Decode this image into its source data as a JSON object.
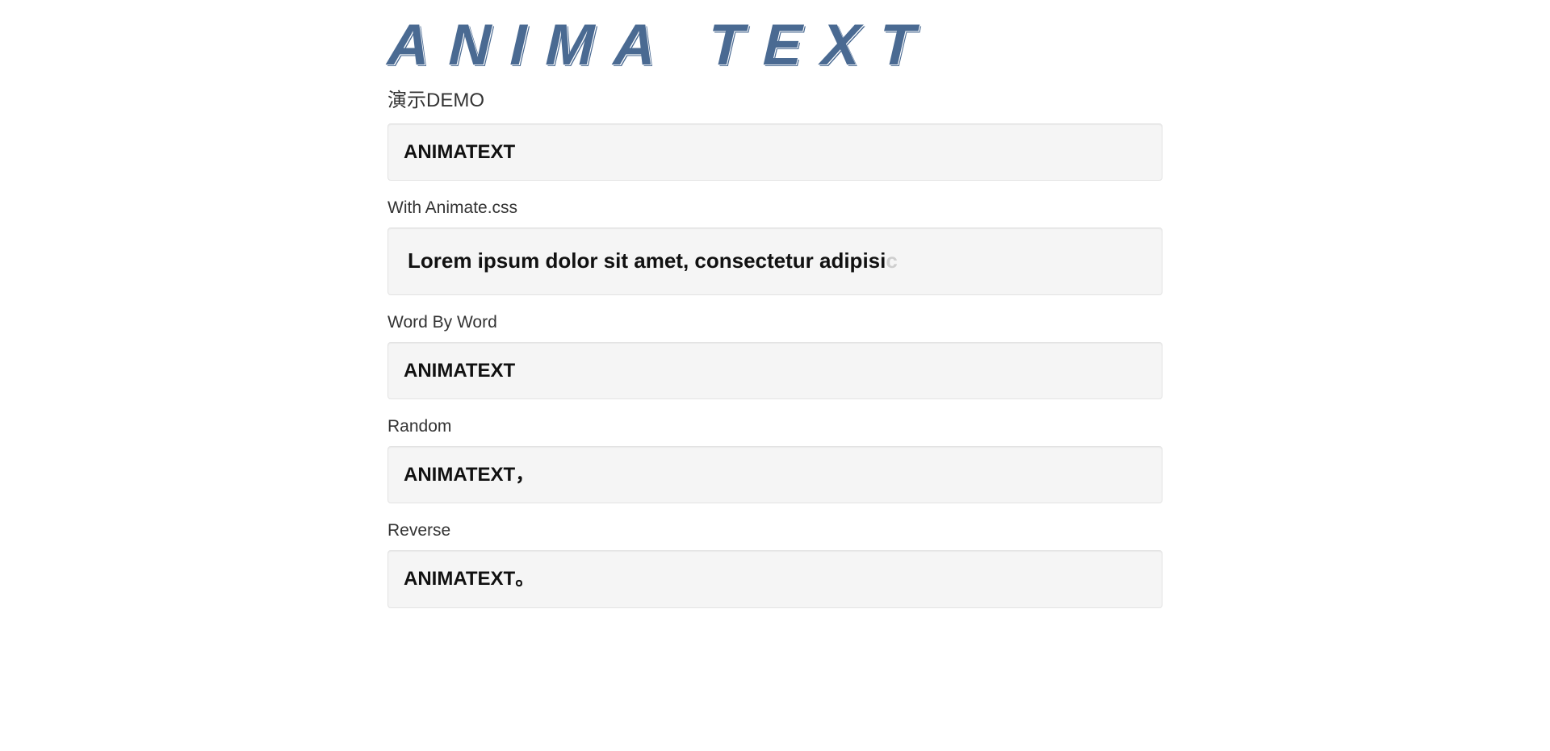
{
  "logo": "ANIMA TEXT",
  "subtitle": "演示DEMO",
  "sections": [
    {
      "label": "",
      "text": "ANIMATEXT",
      "large": false
    },
    {
      "label": "With Animate.css",
      "text": "Lorem ipsum dolor sit amet, consectetur adipisi",
      "trailing_fade_char": "c",
      "large": true
    },
    {
      "label": "Word By Word",
      "text": "ANIMATEXT",
      "large": false
    },
    {
      "label": "Random",
      "text": "ANIMATEXT，",
      "large": false
    },
    {
      "label": "Reverse",
      "text": "ANIMATEXT。",
      "large": false
    }
  ]
}
